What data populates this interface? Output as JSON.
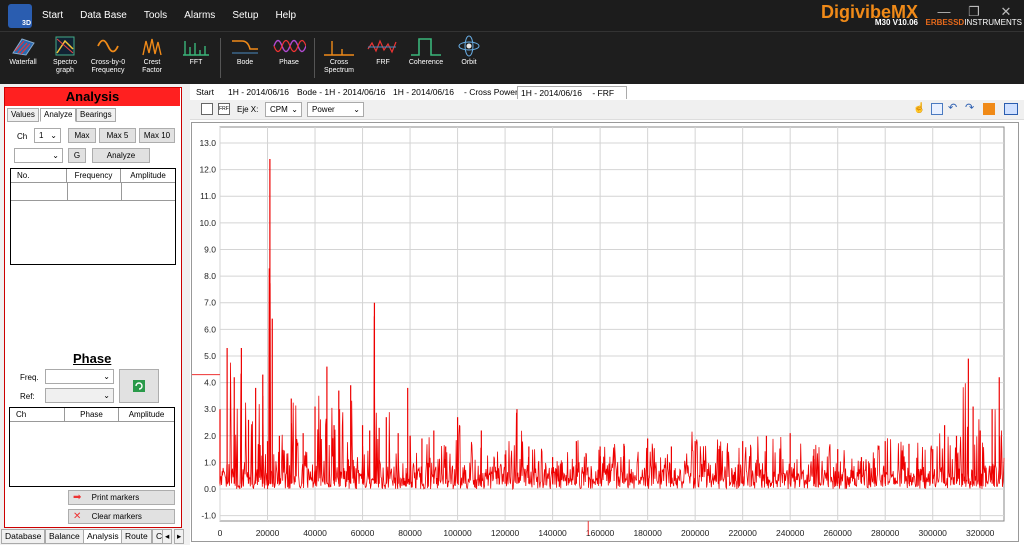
{
  "app": {
    "brand": "DigivibeMX",
    "version": "M30 V10.06",
    "company_prefix": "ERBESSD",
    "company_suffix": "INSTRUMENTS",
    "logo_badge": "3D",
    "menu": [
      "Start",
      "Data Base",
      "Tools",
      "Alarms",
      "Setup",
      "Help"
    ]
  },
  "toolbar": {
    "tools": [
      {
        "line1": "Waterfall",
        "line2": ""
      },
      {
        "line1": "Spectro",
        "line2": "graph"
      },
      {
        "line1": "Cross-by-0",
        "line2": "Frequency"
      },
      {
        "line1": "Crest",
        "line2": "Factor"
      },
      {
        "line1": "FFT",
        "line2": ""
      },
      {
        "line1": "Bode",
        "line2": ""
      },
      {
        "line1": "Phase",
        "line2": ""
      },
      {
        "line1": "Cross",
        "line2": "Spectrum"
      },
      {
        "line1": "FRF",
        "line2": ""
      },
      {
        "line1": "Coherence",
        "line2": ""
      },
      {
        "line1": "Orbit",
        "line2": ""
      }
    ]
  },
  "left": {
    "title": "Analysis",
    "tabs": [
      "Values",
      "Analyze",
      "Bearings"
    ],
    "ch_label": "Ch",
    "ch_value": "1",
    "max": "Max",
    "max5": "Max 5",
    "max10": "Max 10",
    "g_button": "G",
    "analyze_button": "Analyze",
    "peaks_headers": [
      "No.",
      "Frequency",
      "Amplitude"
    ],
    "phase_title": "Phase",
    "freq_label": "Freq.",
    "ref_label": "Ref:",
    "phase_headers": [
      "Ch",
      "Phase",
      "Amplitude"
    ],
    "print_markers": "Print markers",
    "clear_markers": "Clear markers",
    "bottom_tabs": [
      "Database",
      "Balance",
      "Analysis",
      "Route",
      "C"
    ]
  },
  "doc_tabs": [
    "Start",
    "1H - 2014/06/16",
    "Bode - 1H - 2014/06/16",
    "1H - 2014/06/16",
    "- Cross Power",
    "1H - 2014/06/16",
    "- FRF"
  ],
  "plot_toolbar": {
    "eje_label": "Eje X:",
    "eje_value": "CPM",
    "mode_value": "Power"
  },
  "chart_data": {
    "type": "line",
    "title": "",
    "xlabel": "",
    "ylabel": "",
    "xlim": [
      0,
      330000
    ],
    "ylim": [
      -1.2,
      13.6
    ],
    "x_ticks": [
      0,
      20000,
      40000,
      60000,
      80000,
      100000,
      120000,
      140000,
      160000,
      180000,
      200000,
      220000,
      240000,
      260000,
      280000,
      300000,
      320000
    ],
    "y_ticks": [
      "-1.0",
      "0.0",
      "1.0",
      "2.0",
      "3.0",
      "4.0",
      "5.0",
      "6.0",
      "7.0",
      "8.0",
      "9.0",
      "10.0",
      "11.0",
      "12.0",
      "13.0"
    ],
    "grid": true,
    "color": "#ee0000",
    "series": [
      {
        "x": [
          0,
          3000,
          6000,
          9000,
          12000,
          15000,
          18000,
          20000,
          21000,
          22000,
          25000,
          30000,
          35000,
          40000,
          45000,
          48000,
          50000,
          55000,
          60000,
          63000,
          65000,
          67000,
          70000,
          75000,
          79000,
          80000,
          85000,
          90000,
          95000,
          100000,
          110000,
          120000,
          125000,
          130000,
          140000,
          150000,
          160000,
          170000,
          180000,
          190000,
          200000,
          210000,
          220000,
          230000,
          240000,
          250000,
          260000,
          270000,
          280000,
          290000,
          300000,
          305000,
          310000,
          315000,
          317000,
          320000,
          325000,
          328000
        ],
        "y": [
          3.0,
          5.3,
          4.2,
          5.3,
          2.6,
          3.8,
          4.3,
          1.8,
          12.4,
          6.4,
          2.0,
          3.4,
          2.1,
          3.1,
          4.6,
          2.4,
          3.7,
          3.9,
          2.4,
          2.2,
          7.0,
          2.3,
          2.7,
          2.1,
          3.8,
          2.0,
          1.9,
          2.2,
          1.6,
          2.7,
          2.2,
          1.3,
          3.0,
          1.6,
          1.2,
          1.8,
          1.6,
          1.7,
          1.9,
          1.6,
          1.8,
          1.5,
          1.8,
          2.0,
          2.1,
          1.5,
          1.5,
          1.2,
          1.8,
          1.7,
          1.5,
          2.4,
          2.0,
          4.9,
          3.1,
          2.2,
          3.0,
          4.2
        ]
      }
    ]
  }
}
